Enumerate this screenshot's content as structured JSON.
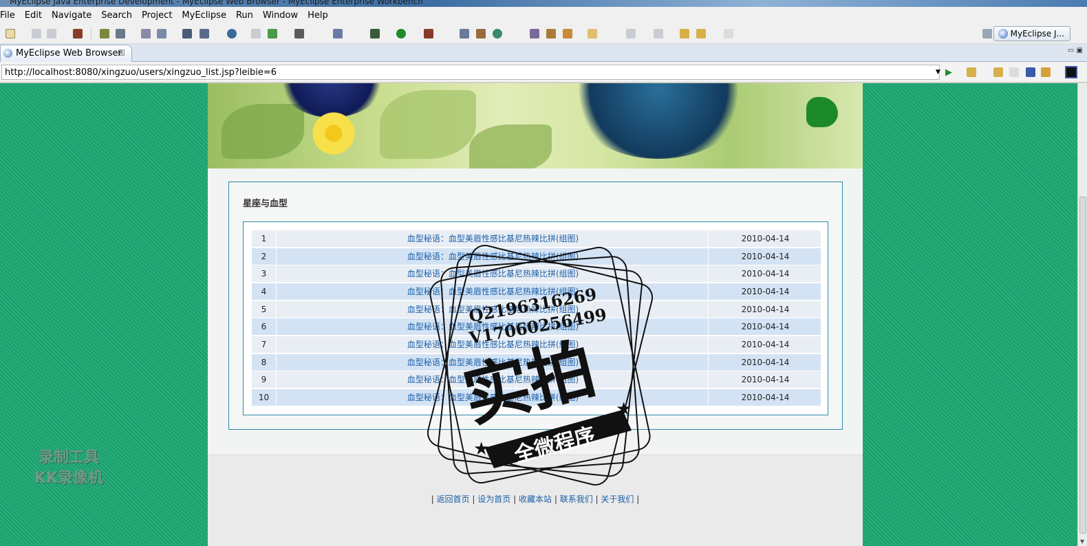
{
  "window": {
    "title": "MyEclipse Java Enterprise Development - MyEclipse Web Browser - MyEclipse Enterprise Workbench"
  },
  "menu": [
    "File",
    "Edit",
    "Navigate",
    "Search",
    "Project",
    "MyEclipse",
    "Run",
    "Window",
    "Help"
  ],
  "perspective": {
    "label": "MyEclipse J..."
  },
  "tab": {
    "label": "MyEclipse Web Browser",
    "close": "☒"
  },
  "address": {
    "url": "http://localhost:8080/xingzuo/users/xingzuo_list.jsp?leibie=6"
  },
  "page": {
    "section_title": "星座与血型",
    "rows": [
      {
        "num": "1",
        "title": "血型秘语：血型美眉性感比基尼热辣比拼(组图)",
        "date": "2010-04-14"
      },
      {
        "num": "2",
        "title": "血型秘语：血型美眉性感比基尼热辣比拼(组图)",
        "date": "2010-04-14"
      },
      {
        "num": "3",
        "title": "血型秘语：血型美眉性感比基尼热辣比拼(组图)",
        "date": "2010-04-14"
      },
      {
        "num": "4",
        "title": "血型秘语：血型美眉性感比基尼热辣比拼(组图)",
        "date": "2010-04-14"
      },
      {
        "num": "5",
        "title": "血型秘语：血型美眉性感比基尼热辣比拼(组图)",
        "date": "2010-04-14"
      },
      {
        "num": "6",
        "title": "血型秘语：血型美眉性感比基尼热辣比拼(组图)",
        "date": "2010-04-14"
      },
      {
        "num": "7",
        "title": "血型秘语：血型美眉性感比基尼热辣比拼(组图)",
        "date": "2010-04-14"
      },
      {
        "num": "8",
        "title": "血型秘语：血型美眉性感比基尼热辣比拼(组图)",
        "date": "2010-04-14"
      },
      {
        "num": "9",
        "title": "血型秘语：血型美眉性感比基尼热辣比拼(组图)",
        "date": "2010-04-14"
      },
      {
        "num": "10",
        "title": "血型秘语：血型美眉性感比基尼热辣比拼(组图)",
        "date": "2010-04-14"
      }
    ],
    "footer_links": [
      "返回首页",
      "设为首页",
      "收藏本站",
      "联系我们",
      "关于我们"
    ],
    "footer_sep": "|"
  },
  "overlays": {
    "recorder_line1": "录制工具",
    "recorder_line2": "KK录像机",
    "stamp_q": "Q2196316269",
    "stamp_v": "V17060256499",
    "stamp_main": "实拍",
    "stamp_sub": "全微程序"
  },
  "colors": {
    "page_bg_green": "#1e9c6b",
    "link_blue": "#1a5ea8",
    "panel_border": "#2a8aa8",
    "row_odd": "#e9eef4",
    "row_even": "#d3e3f4"
  }
}
